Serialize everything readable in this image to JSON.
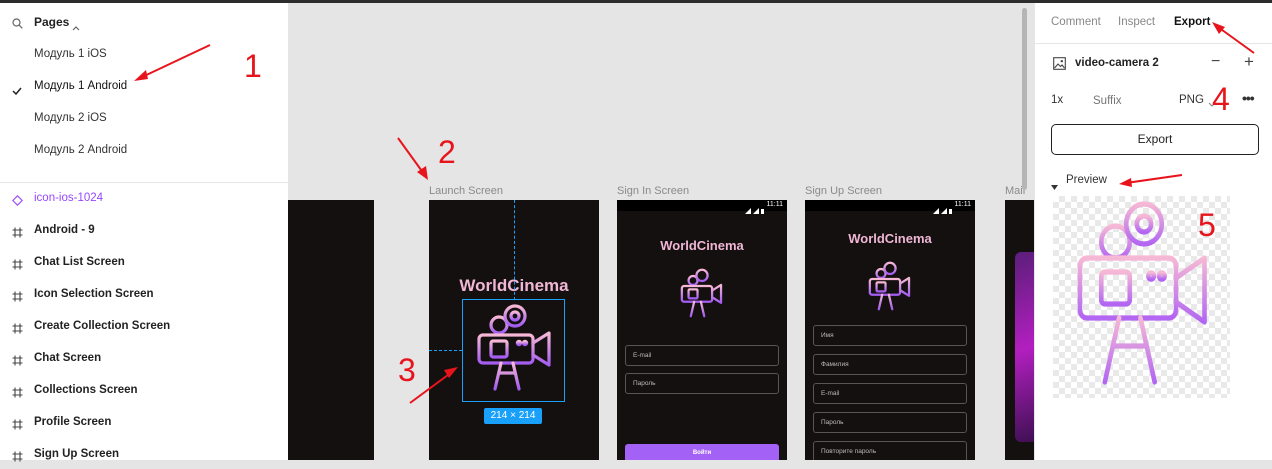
{
  "sidebar": {
    "pages_header": "Pages",
    "pages": [
      {
        "label": "Модуль 1 iOS",
        "active": false
      },
      {
        "label": "Модуль 1 Android",
        "active": true
      },
      {
        "label": "Модуль 2 iOS",
        "active": false
      },
      {
        "label": "Модуль 2 Android",
        "active": false
      }
    ],
    "layers": [
      {
        "label": "icon-ios-1024",
        "type": "component"
      },
      {
        "label": "Android - 9",
        "type": "frame"
      },
      {
        "label": "Chat List Screen",
        "type": "frame"
      },
      {
        "label": "Icon Selection Screen",
        "type": "frame"
      },
      {
        "label": "Create Collection Screen",
        "type": "frame"
      },
      {
        "label": "Chat Screen",
        "type": "frame"
      },
      {
        "label": "Collections Screen",
        "type": "frame"
      },
      {
        "label": "Profile Screen",
        "type": "frame"
      },
      {
        "label": "Sign Up Screen",
        "type": "frame"
      }
    ]
  },
  "canvas": {
    "frames": [
      {
        "label": "Launch Screen"
      },
      {
        "label": "Sign In Screen"
      },
      {
        "label": "Sign Up Screen"
      },
      {
        "label": "Main"
      }
    ],
    "brand": "WorldCinema",
    "selection_size": "214 × 214",
    "status_time": "11:11",
    "signin_fields": [
      "E-mail",
      "Пароль"
    ],
    "signin_button": "Войти",
    "signup_fields": [
      "Имя",
      "Фамилия",
      "E-mail",
      "Пароль",
      "Повторите пароль"
    ]
  },
  "panel": {
    "tabs": [
      {
        "label": "Comment",
        "active": false
      },
      {
        "label": "Inspect",
        "active": false
      },
      {
        "label": "Export",
        "active": true
      }
    ],
    "asset_name": "video-camera 2",
    "scale": "1x",
    "suffix_placeholder": "Suffix",
    "format": "PNG",
    "export_button": "Export",
    "preview_label": "Preview"
  },
  "annotations": [
    "1",
    "2",
    "3",
    "4",
    "5"
  ],
  "colors": {
    "accent_purple": "#9747ff",
    "selection_blue": "#18a0fb",
    "annotation_red": "#e8141c",
    "frame_bg": "#141010",
    "brand_pink": "#f0b6d4"
  }
}
